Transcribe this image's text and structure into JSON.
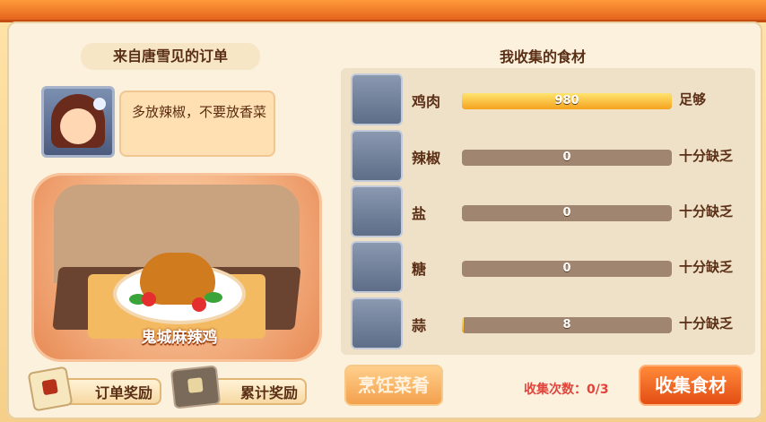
{
  "order_panel": {
    "title": "来自唐雪见的订单",
    "request_text": "多放辣椒，不要放香菜",
    "dish_name": "鬼城麻辣鸡",
    "order_reward_label": "订单奖励",
    "cumulative_reward_label": "累计奖励"
  },
  "ingredients_panel": {
    "title": "我收集的食材",
    "items": [
      {
        "name": "鸡肉",
        "value": "980",
        "fill": 1.0,
        "status": "足够",
        "icon": "roast-chicken-icon"
      },
      {
        "name": "辣椒",
        "value": "0",
        "fill": 0.0,
        "status": "十分缺乏",
        "icon": "chili-bowl-icon"
      },
      {
        "name": "盐",
        "value": "0",
        "fill": 0.0,
        "status": "十分缺乏",
        "icon": "salt-bowl-icon"
      },
      {
        "name": "糖",
        "value": "0",
        "fill": 0.0,
        "status": "十分缺乏",
        "icon": "sugar-plate-icon"
      },
      {
        "name": "蒜",
        "value": "8",
        "fill": 0.01,
        "status": "十分缺乏",
        "icon": "garlic-plate-icon"
      }
    ]
  },
  "actions": {
    "cook_label": "烹饪菜肴",
    "collect_count_label": "收集次数：0/3",
    "collect_label": "收集食材"
  },
  "colors": {
    "accent_orange": "#e34e14",
    "text_brown": "#5a2f16",
    "warning_red": "#e2433a"
  }
}
